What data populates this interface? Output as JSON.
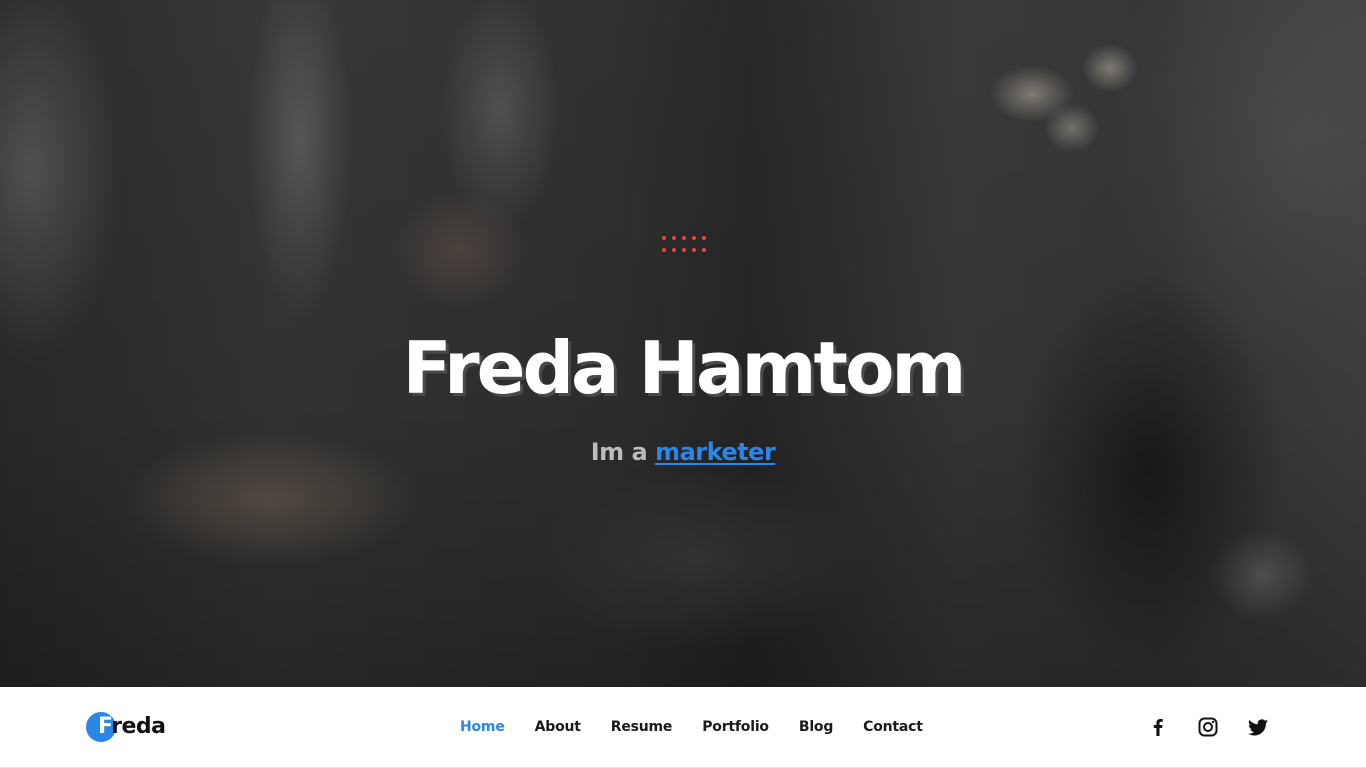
{
  "hero": {
    "name": "Freda Hamtom",
    "tagline_prefix": "Im a",
    "tagline_role": "marketer"
  },
  "navbar": {
    "logo": {
      "first_letter": "F",
      "rest": "reda"
    },
    "links": [
      {
        "label": "Home",
        "active": true
      },
      {
        "label": "About",
        "active": false
      },
      {
        "label": "Resume",
        "active": false
      },
      {
        "label": "Portfolio",
        "active": false
      },
      {
        "label": "Blog",
        "active": false
      },
      {
        "label": "Contact",
        "active": false
      }
    ],
    "social": [
      {
        "icon": "facebook-icon"
      },
      {
        "icon": "instagram-icon"
      },
      {
        "icon": "twitter-icon"
      }
    ]
  },
  "colors": {
    "accent": "#2a86e8",
    "dots": "#e8453c",
    "nav_text": "#1a1a1a"
  }
}
